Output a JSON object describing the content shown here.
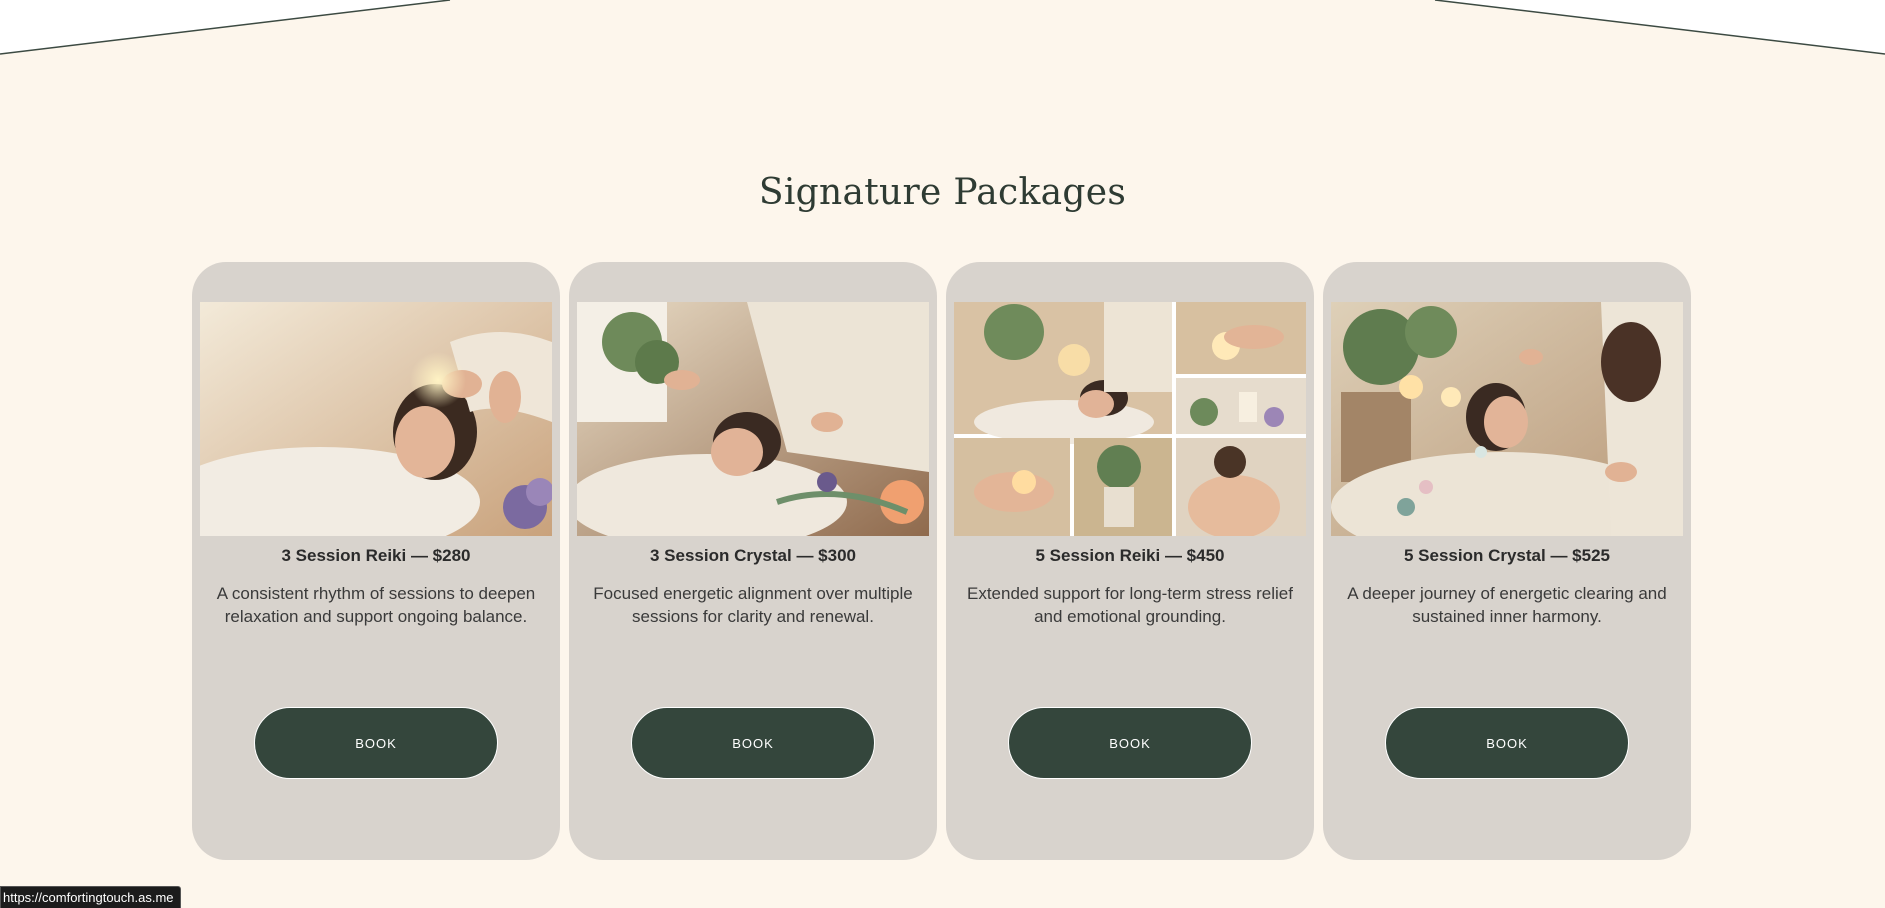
{
  "section": {
    "title": "Signature Packages"
  },
  "packages": [
    {
      "title": "3 Session Reiki — $280",
      "description": "A consistent rhythm of sessions to deepen relaxation and support ongoing balance.",
      "button_label": "BOOK"
    },
    {
      "title": "3 Session Crystal — $300",
      "description": "Focused energetic alignment over multiple sessions for clarity and renewal.",
      "button_label": "BOOK"
    },
    {
      "title": "5 Session Reiki — $450",
      "description": "Extended support for long-term stress relief and emotional grounding.",
      "button_label": "BOOK"
    },
    {
      "title": "5 Session Crystal — $525",
      "description": "A deeper journey of energetic clearing and sustained inner harmony.",
      "button_label": "BOOK"
    }
  ],
  "status_bar": {
    "url": "https://comfortingtouch.as.me"
  },
  "colors": {
    "page_background": "#fdf6ec",
    "card_background": "#d8d3cd",
    "button_background": "#34463c",
    "title_color": "#2e3b33"
  }
}
